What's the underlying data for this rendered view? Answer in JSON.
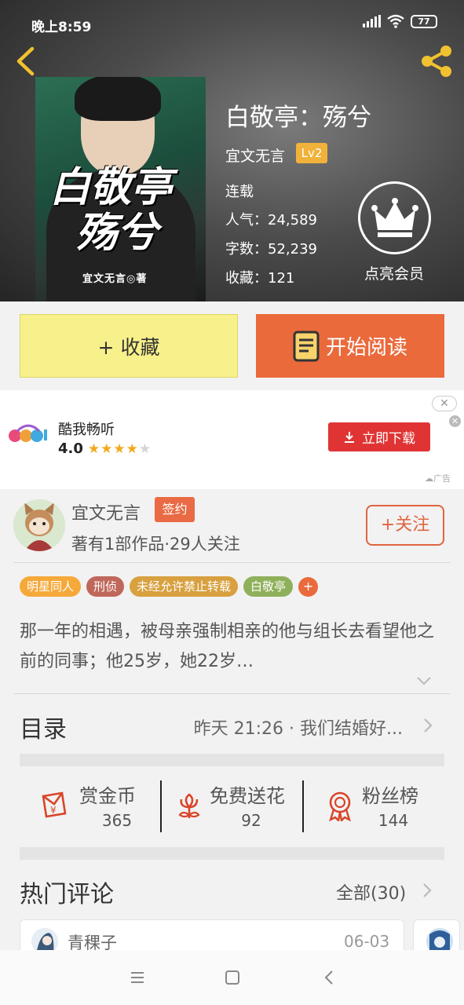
{
  "status_bar": {
    "time": "晚上8:59",
    "battery": "77"
  },
  "book": {
    "cover_title_line1": "白敬亭",
    "cover_title_line2": "殇兮",
    "cover_author": "宜文无言◎著",
    "title": "白敬亭：殇兮",
    "author": "宜文无言",
    "author_level": "Lv2",
    "status": "连载",
    "popularity": "人气：24,589",
    "word_count": "字数：52,239",
    "favorites": "收藏：121",
    "member_label": "点亮会员"
  },
  "actions": {
    "collect": "+ 收藏",
    "read": "开始阅读"
  },
  "ad": {
    "app_name": "酷我畅听",
    "rating": "4.0",
    "stars_filled": 4,
    "stars_total": 5,
    "download": "立即下载",
    "ad_label": "广告"
  },
  "author_section": {
    "name": "宜文无言",
    "badge": "签约",
    "stats": "著有1部作品·29人关注",
    "follow": "+关注"
  },
  "tags": [
    {
      "label": "明星同人",
      "color": "#f5a93a"
    },
    {
      "label": "刑侦",
      "color": "#c0675b"
    },
    {
      "label": "未经允许禁止转载",
      "color": "#d8a03f"
    },
    {
      "label": "白敬亭",
      "color": "#8fb05a"
    }
  ],
  "tag_more": "+",
  "description": "那一年的相遇，被母亲强制相亲的他与组长去看望他之前的同事；他25岁，她22岁…",
  "toc": {
    "title": "目录",
    "latest": "昨天 21:26 · 我们结婚好..."
  },
  "stats_row": [
    {
      "label": "赏金币",
      "value": "365",
      "icon": "coin-red-envelope-icon"
    },
    {
      "label": "免费送花",
      "value": "92",
      "icon": "flower-icon"
    },
    {
      "label": "粉丝榜",
      "value": "144",
      "icon": "medal-icon"
    }
  ],
  "comments": {
    "title": "热门评论",
    "all": "全部(30)",
    "first": {
      "user": "青稞子",
      "date": "06-03"
    }
  },
  "colors": {
    "accent": "#ea6a3c",
    "collect_bg": "#f8f18b",
    "ad_button": "#e03434"
  }
}
